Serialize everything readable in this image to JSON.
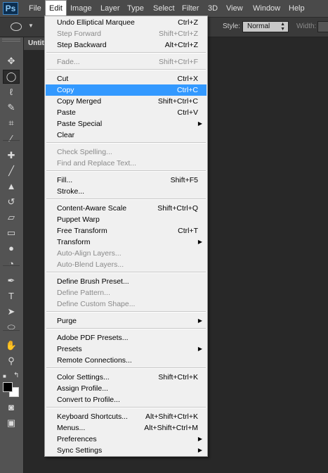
{
  "app": {
    "logo": "Ps"
  },
  "menubar": {
    "items": [
      "File",
      "Edit",
      "Image",
      "Layer",
      "Type",
      "Select",
      "Filter",
      "3D",
      "View",
      "Window",
      "Help"
    ],
    "active": "Edit"
  },
  "options": {
    "style_label": "Style:",
    "style_value": "Normal",
    "width_label": "Width:"
  },
  "document": {
    "tab_title": "Untit"
  },
  "edit_menu": {
    "items": [
      {
        "label": "Undo Elliptical Marquee",
        "shortcut": "Ctrl+Z",
        "enabled": true
      },
      {
        "label": "Step Forward",
        "shortcut": "Shift+Ctrl+Z",
        "enabled": false
      },
      {
        "label": "Step Backward",
        "shortcut": "Alt+Ctrl+Z",
        "enabled": true
      },
      {
        "label": "Fade...",
        "shortcut": "Shift+Ctrl+F",
        "enabled": false
      },
      {
        "label": "Cut",
        "shortcut": "Ctrl+X",
        "enabled": true
      },
      {
        "label": "Copy",
        "shortcut": "Ctrl+C",
        "enabled": true,
        "highlighted": true
      },
      {
        "label": "Copy Merged",
        "shortcut": "Shift+Ctrl+C",
        "enabled": true
      },
      {
        "label": "Paste",
        "shortcut": "Ctrl+V",
        "enabled": true
      },
      {
        "label": "Paste Special",
        "shortcut": "",
        "enabled": true,
        "submenu": true
      },
      {
        "label": "Clear",
        "shortcut": "",
        "enabled": true
      },
      {
        "label": "Check Spelling...",
        "shortcut": "",
        "enabled": false
      },
      {
        "label": "Find and Replace Text...",
        "shortcut": "",
        "enabled": false
      },
      {
        "label": "Fill...",
        "shortcut": "Shift+F5",
        "enabled": true
      },
      {
        "label": "Stroke...",
        "shortcut": "",
        "enabled": true
      },
      {
        "label": "Content-Aware Scale",
        "shortcut": "Shift+Ctrl+Q",
        "enabled": true
      },
      {
        "label": "Puppet Warp",
        "shortcut": "",
        "enabled": true
      },
      {
        "label": "Free Transform",
        "shortcut": "Ctrl+T",
        "enabled": true
      },
      {
        "label": "Transform",
        "shortcut": "",
        "enabled": true,
        "submenu": true
      },
      {
        "label": "Auto-Align Layers...",
        "shortcut": "",
        "enabled": false
      },
      {
        "label": "Auto-Blend Layers...",
        "shortcut": "",
        "enabled": false
      },
      {
        "label": "Define Brush Preset...",
        "shortcut": "",
        "enabled": true
      },
      {
        "label": "Define Pattern...",
        "shortcut": "",
        "enabled": false
      },
      {
        "label": "Define Custom Shape...",
        "shortcut": "",
        "enabled": false
      },
      {
        "label": "Purge",
        "shortcut": "",
        "enabled": true,
        "submenu": true
      },
      {
        "label": "Adobe PDF Presets...",
        "shortcut": "",
        "enabled": true
      },
      {
        "label": "Presets",
        "shortcut": "",
        "enabled": true,
        "submenu": true
      },
      {
        "label": "Remote Connections...",
        "shortcut": "",
        "enabled": true
      },
      {
        "label": "Color Settings...",
        "shortcut": "Shift+Ctrl+K",
        "enabled": true
      },
      {
        "label": "Assign Profile...",
        "shortcut": "",
        "enabled": true
      },
      {
        "label": "Convert to Profile...",
        "shortcut": "",
        "enabled": true
      },
      {
        "label": "Keyboard Shortcuts...",
        "shortcut": "Alt+Shift+Ctrl+K",
        "enabled": true
      },
      {
        "label": "Menus...",
        "shortcut": "Alt+Shift+Ctrl+M",
        "enabled": true
      },
      {
        "label": "Preferences",
        "shortcut": "",
        "enabled": true,
        "submenu": true
      },
      {
        "label": "Sync Settings",
        "shortcut": "",
        "enabled": true,
        "submenu": true
      }
    ]
  },
  "toolbar": {
    "tools": [
      {
        "name": "move-tool",
        "glyph": "✥"
      },
      {
        "name": "elliptical-marquee-tool",
        "glyph": "◯",
        "selected": true
      },
      {
        "name": "lasso-tool",
        "glyph": "ℓ"
      },
      {
        "name": "quick-selection-tool",
        "glyph": "✎"
      },
      {
        "name": "crop-tool",
        "glyph": "⌗"
      },
      {
        "name": "eyedropper-tool",
        "glyph": "⁄"
      },
      {
        "name": "healing-brush-tool",
        "glyph": "✚"
      },
      {
        "name": "brush-tool",
        "glyph": "╱"
      },
      {
        "name": "clone-stamp-tool",
        "glyph": "▲"
      },
      {
        "name": "history-brush-tool",
        "glyph": "↺"
      },
      {
        "name": "eraser-tool",
        "glyph": "▱"
      },
      {
        "name": "gradient-tool",
        "glyph": "▭"
      },
      {
        "name": "blur-tool",
        "glyph": "●"
      },
      {
        "name": "dodge-tool",
        "glyph": "◔"
      },
      {
        "name": "pen-tool",
        "glyph": "✒"
      },
      {
        "name": "type-tool",
        "glyph": "T"
      },
      {
        "name": "path-selection-tool",
        "glyph": "➤"
      },
      {
        "name": "ellipse-shape-tool",
        "glyph": "⬭"
      },
      {
        "name": "hand-tool",
        "glyph": "✋"
      },
      {
        "name": "zoom-tool",
        "glyph": "⚲"
      }
    ],
    "extra": [
      {
        "name": "quick-mask-icon",
        "glyph": "◙"
      },
      {
        "name": "screen-mode-icon",
        "glyph": "▣"
      }
    ]
  }
}
